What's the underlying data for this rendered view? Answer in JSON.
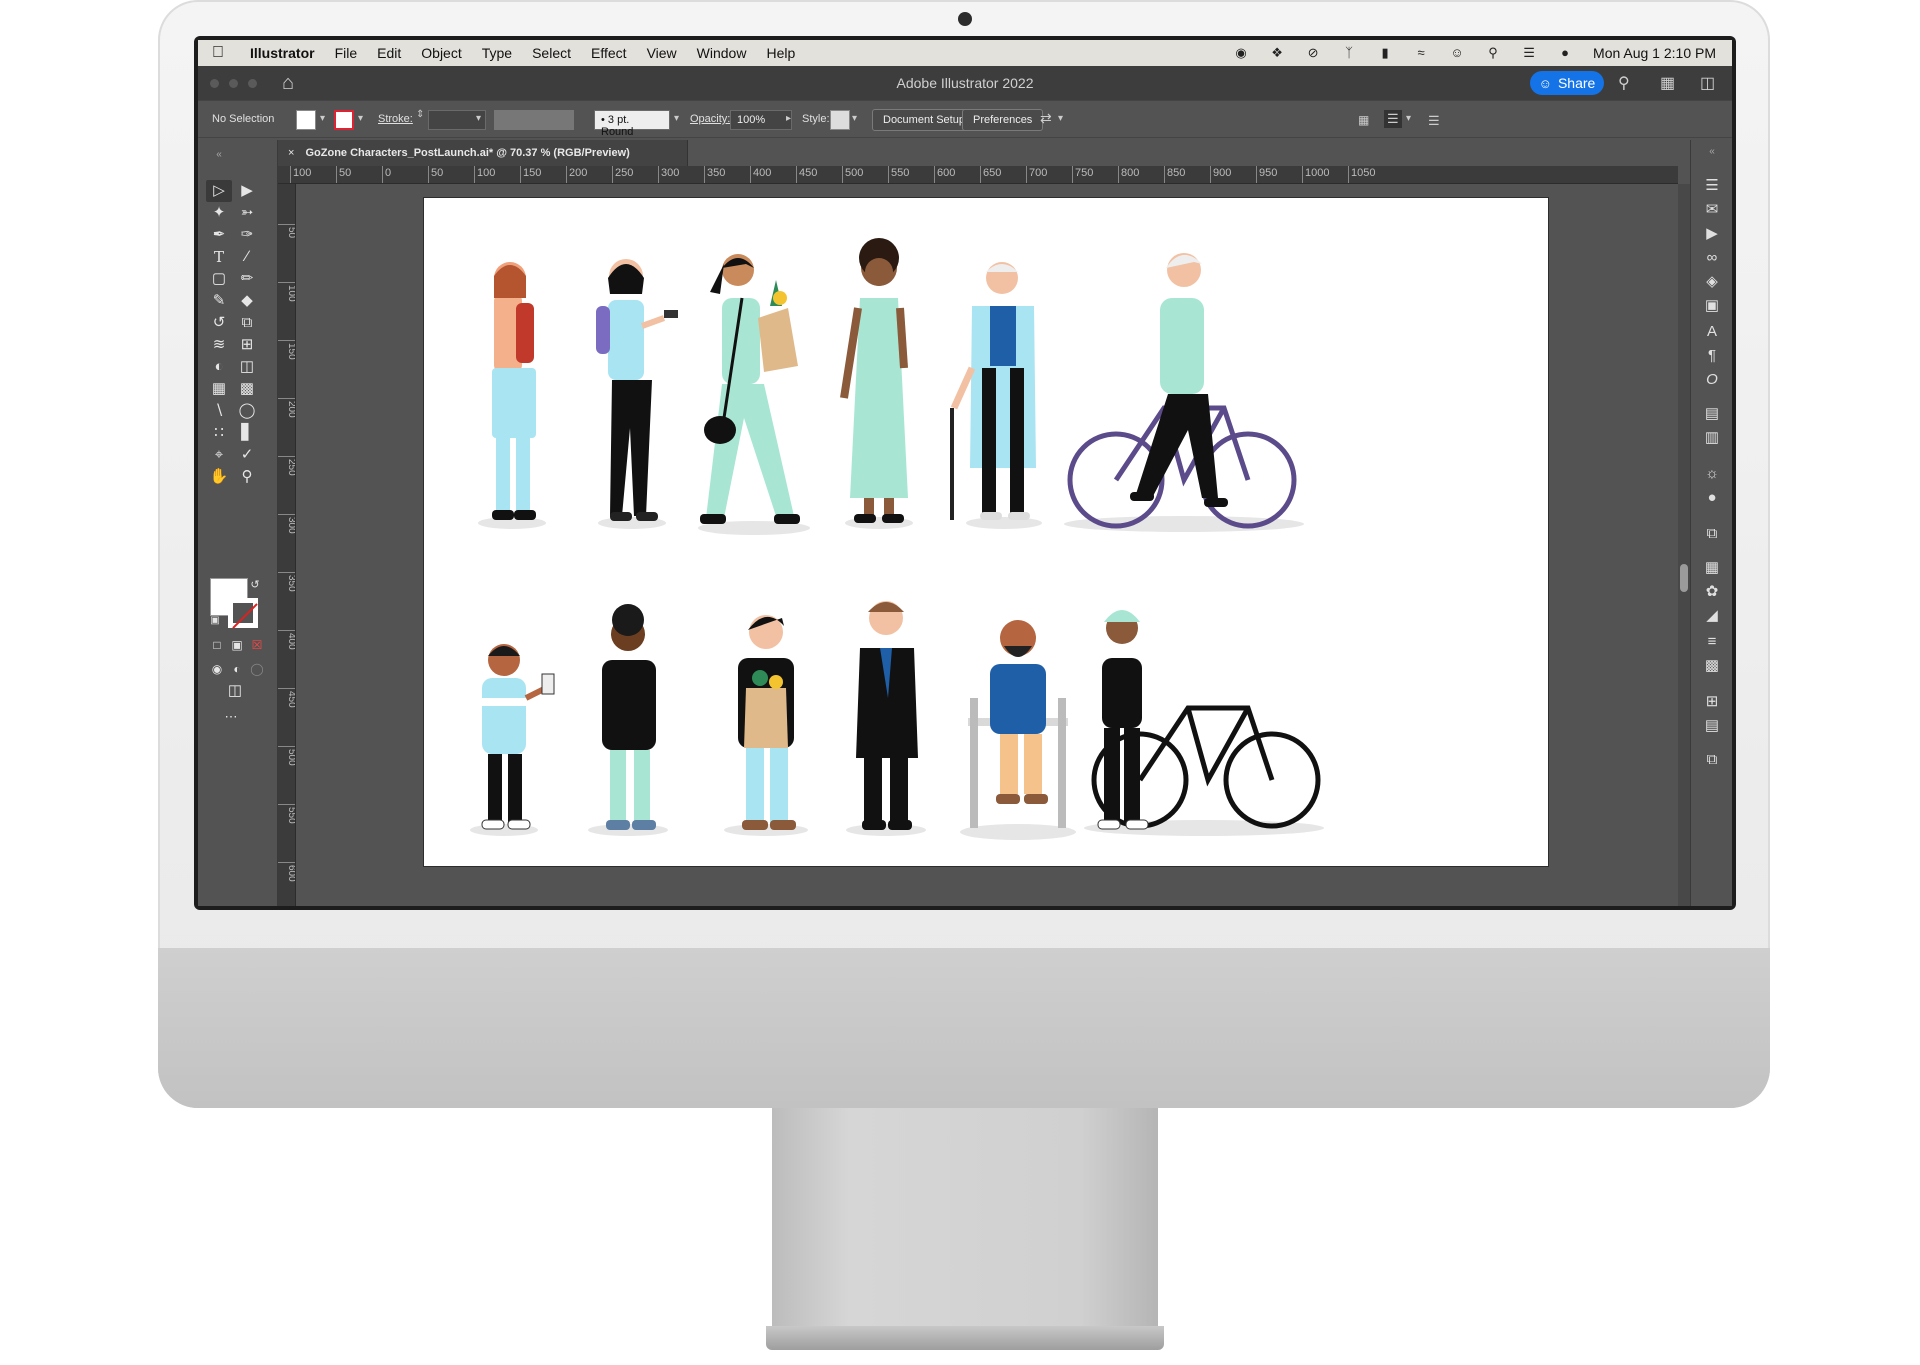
{
  "menubar": {
    "app_name": "Illustrator",
    "items": [
      "File",
      "Edit",
      "Object",
      "Type",
      "Select",
      "Effect",
      "View",
      "Window",
      "Help"
    ],
    "clock": "Mon Aug 1  2:10 PM"
  },
  "app": {
    "title": "Adobe Illustrator 2022",
    "share_label": "Share"
  },
  "controlbar": {
    "selection": "No Selection",
    "stroke_label": "Stroke:",
    "brush": "3 pt. Round",
    "opacity_label": "Opacity:",
    "opacity_value": "100%",
    "style_label": "Style:",
    "document_setup": "Document Setup",
    "preferences": "Preferences"
  },
  "document": {
    "tab_title": "GoZone Characters_PostLaunch.ai* @ 70.37 % (RGB/Preview)"
  },
  "ruler": {
    "h_labels": [
      "100",
      "50",
      "0",
      "50",
      "100",
      "150",
      "200",
      "250",
      "300",
      "350",
      "400",
      "450",
      "500",
      "550",
      "600",
      "650",
      "700",
      "750",
      "800",
      "850",
      "900",
      "950",
      "1000",
      "1050"
    ],
    "v_labels": [
      "50",
      "100",
      "150",
      "200",
      "250",
      "300",
      "350",
      "400",
      "450",
      "500",
      "550",
      "600"
    ]
  },
  "colors": {
    "accent": "#1473e6",
    "workspace": "#535353",
    "artboard": "#ffffff",
    "mint": "#a8e6d3",
    "sky": "#a9e4f3",
    "purple": "#5b4b8a"
  },
  "icons": {
    "toolbar": [
      "selection-tool-icon",
      "direct-selection-tool-icon",
      "magic-wand-icon",
      "lasso-icon",
      "pen-tool-icon",
      "curvature-icon",
      "type-tool-icon",
      "line-tool-icon",
      "rectangle-tool-icon",
      "paintbrush-icon",
      "shaper-icon",
      "eraser-icon",
      "rotate-icon",
      "scale-icon",
      "warp-icon",
      "free-transform-icon",
      "shape-builder-icon",
      "perspective-icon",
      "mesh-icon",
      "gradient-icon",
      "eyedropper-icon",
      "blend-icon",
      "symbol-sprayer-icon",
      "column-graph-icon",
      "artboard-tool-icon",
      "slice-icon",
      "hand-tool-icon",
      "zoom-tool-icon"
    ],
    "panels": [
      "properties-icon",
      "comments-icon",
      "actions-icon",
      "links-icon",
      "layers-icon",
      "libraries-icon",
      "character-icon",
      "paragraph-icon",
      "opentype-icon",
      "character-styles-icon",
      "paragraph-styles-icon",
      "appearance-icon",
      "graphic-styles-icon",
      "transparency-icon",
      "swatches-icon",
      "color-icon",
      "color-guide-icon",
      "stroke-icon",
      "gradient-panel-icon",
      "transform-icon",
      "align-icon",
      "pathfinder-icon"
    ]
  }
}
